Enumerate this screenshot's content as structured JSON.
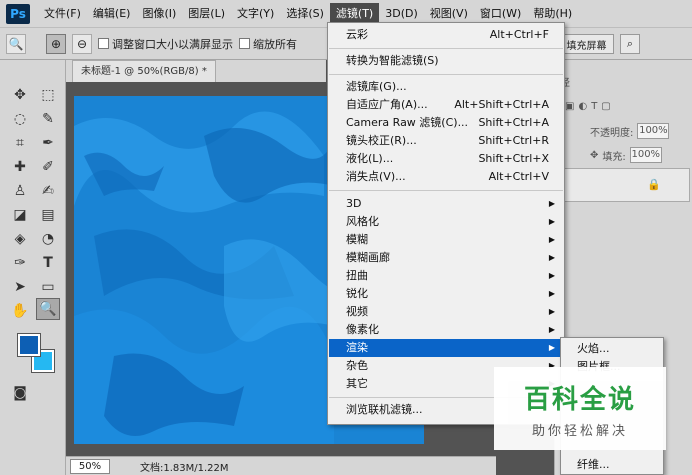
{
  "app": {
    "logo": "Ps"
  },
  "menubar": [
    {
      "label": "文件(F)"
    },
    {
      "label": "编辑(E)"
    },
    {
      "label": "图像(I)"
    },
    {
      "label": "图层(L)"
    },
    {
      "label": "文字(Y)"
    },
    {
      "label": "选择(S)"
    },
    {
      "label": "滤镜(T)",
      "active": true
    },
    {
      "label": "3D(D)"
    },
    {
      "label": "视图(V)"
    },
    {
      "label": "窗口(W)"
    },
    {
      "label": "帮助(H)"
    }
  ],
  "options": {
    "resize_windows_label": "调整窗口大小以满屏显示",
    "zoom_all_label": "缩放所有",
    "fill_screen_label": "填充屏幕"
  },
  "document": {
    "tab_title": "未标题-1 @ 50%(RGB/8) *",
    "zoom": "50%",
    "doc_info": "文档:1.83M/1.22M"
  },
  "panels": {
    "tab_fragment": "径",
    "opacity_label": "不透明度:",
    "opacity_value": "100%",
    "fill_label": "填充:",
    "fill_value": "100%"
  },
  "filter_menu": {
    "items": [
      {
        "label": "云彩",
        "shortcut": "Alt+Ctrl+F"
      },
      {
        "label": "转换为智能滤镜(S)",
        "shortcut": ""
      },
      {
        "label": "滤镜库(G)...",
        "shortcut": ""
      },
      {
        "label": "自适应广角(A)...",
        "shortcut": "Alt+Shift+Ctrl+A"
      },
      {
        "label": "Camera Raw 滤镜(C)...",
        "shortcut": "Shift+Ctrl+A"
      },
      {
        "label": "镜头校正(R)...",
        "shortcut": "Shift+Ctrl+R"
      },
      {
        "label": "液化(L)...",
        "shortcut": "Shift+Ctrl+X"
      },
      {
        "label": "消失点(V)...",
        "shortcut": "Alt+Ctrl+V"
      },
      {
        "label": "3D",
        "submenu": true
      },
      {
        "label": "风格化",
        "submenu": true
      },
      {
        "label": "模糊",
        "submenu": true
      },
      {
        "label": "模糊画廊",
        "submenu": true
      },
      {
        "label": "扭曲",
        "submenu": true
      },
      {
        "label": "锐化",
        "submenu": true
      },
      {
        "label": "视频",
        "submenu": true
      },
      {
        "label": "像素化",
        "submenu": true
      },
      {
        "label": "渲染",
        "submenu": true,
        "highlighted": true
      },
      {
        "label": "杂色",
        "submenu": true
      },
      {
        "label": "其它",
        "submenu": true
      },
      {
        "label": "浏览联机滤镜...",
        "shortcut": ""
      }
    ]
  },
  "render_submenu": {
    "items": [
      {
        "label": "火焰..."
      },
      {
        "label": "图片框..."
      },
      {
        "label": "纤维..."
      }
    ]
  },
  "watermark": {
    "title": "百科全说",
    "subtitle": "助你轻松解决"
  },
  "colors": {
    "foreground": "#0d5fb4",
    "background": "#25b8f2",
    "highlight": "#0a64c8"
  }
}
